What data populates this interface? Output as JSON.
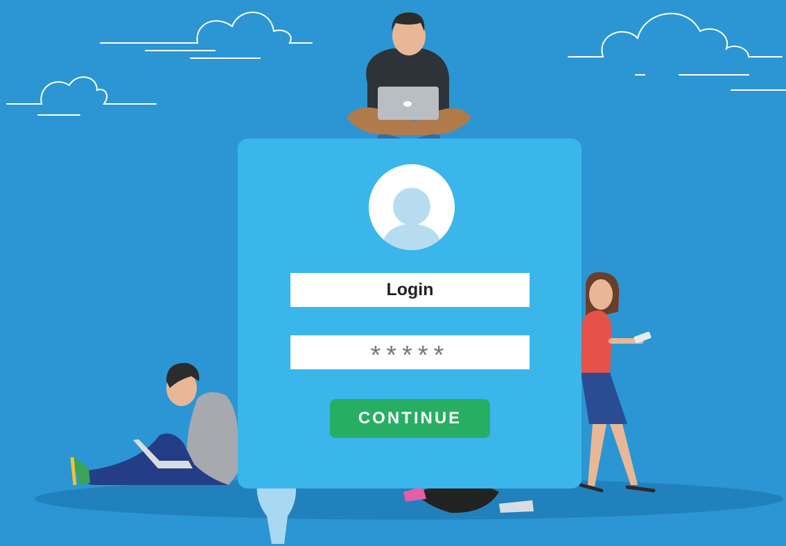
{
  "theme": {
    "background": "#2b96d3",
    "card": "#3bb6ea",
    "button": "#27ae62"
  },
  "form": {
    "login_label": "Login",
    "password_mask": "*****",
    "continue_label": "CONTINUE"
  },
  "icons": {
    "avatar": "user-profile-icon"
  }
}
